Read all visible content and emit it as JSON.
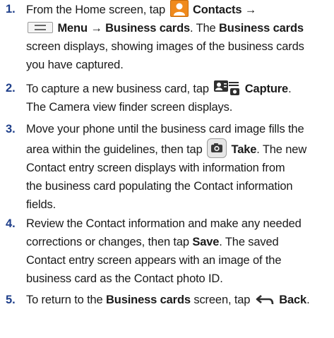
{
  "steps": [
    {
      "number": "1.",
      "parts": {
        "a": "From the Home screen, tap ",
        "b": "Contacts",
        "c": " → ",
        "d": "Menu",
        "e": " → ",
        "f": "Business cards",
        "g": ". The ",
        "h": "Business cards",
        "i": "screen displays, showing images of the business cards",
        "j": "you have captured."
      }
    },
    {
      "number": "2.",
      "parts": {
        "a": "To capture a new business card, tap ",
        "b": "Capture",
        "c": ".",
        "d": "The Camera view finder screen displays."
      }
    },
    {
      "number": "3.",
      "parts": {
        "a": "Move your phone until the business card image fills the",
        "b": "area within the guidelines, then tap ",
        "c": "Take",
        "d": ". The new",
        "e": "Contact entry screen displays with information from",
        "f": "the business card populating the Contact information",
        "g": "fields."
      }
    },
    {
      "number": "4.",
      "parts": {
        "a": "Review the Contact information and make any needed",
        "b": "corrections or changes, then tap ",
        "c": "Save",
        "d": ". The saved",
        "e": "Contact entry screen appears with an image of the",
        "f": "business card as the Contact photo ID."
      }
    },
    {
      "number": "5.",
      "parts": {
        "a": "To return to the ",
        "b": "Business cards",
        "c": " screen, tap ",
        "d": "Back",
        "e": "."
      }
    }
  ],
  "icons": {
    "contacts": "contacts-icon",
    "menu": "menu-icon",
    "capture": "capture-icon",
    "take": "camera-take-icon",
    "back": "back-arrow-icon"
  },
  "colors": {
    "step_number": "#1f3f8a",
    "contacts_icon": "#f08a1c"
  }
}
